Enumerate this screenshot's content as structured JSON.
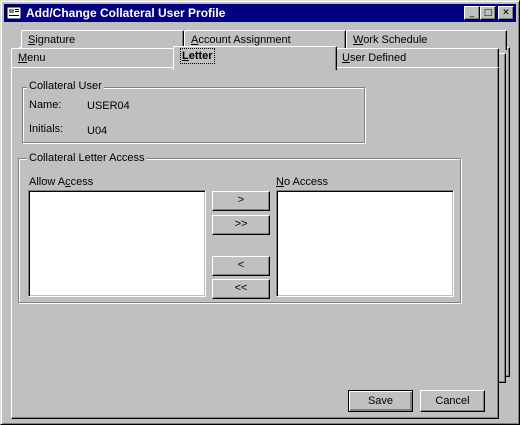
{
  "window": {
    "title": "Add/Change Collateral User Profile",
    "controls": {
      "minimize": "_",
      "maximize": "□",
      "close": "✕"
    }
  },
  "tabs": {
    "back_row": [
      {
        "label": "Signature",
        "mnemonic": "S",
        "rest": "ignature"
      },
      {
        "label": "Account Assignment",
        "mnemonic": "A",
        "rest": "ccount Assignment"
      },
      {
        "label": "Work Schedule",
        "mnemonic": "W",
        "rest": "ork Schedule"
      }
    ],
    "front_row": [
      {
        "label": "Menu",
        "mnemonic": "M",
        "rest": "enu"
      },
      {
        "label": "Letter",
        "mnemonic": "L",
        "rest": "etter",
        "selected": true
      },
      {
        "label": "User Defined",
        "mnemonic": "U",
        "rest": "ser Defined"
      }
    ]
  },
  "collateral_user": {
    "group_label": "Collateral User",
    "name_label": "Name:",
    "name_value": "USER04",
    "initials_label": "Initials:",
    "initials_value": "U04"
  },
  "letter_access": {
    "group_label": "Collateral Letter Access",
    "allow_label_pre": "Allow A",
    "allow_label_mn": "c",
    "allow_label_post": "cess",
    "allow_items": [],
    "no_access_label_mn": "N",
    "no_access_label_post": "o Access",
    "no_items": [],
    "move_one_right": ">",
    "move_all_right": ">>",
    "move_one_left": "<",
    "move_all_left": "<<"
  },
  "footer": {
    "save_label": "Save",
    "cancel_label": "Cancel"
  },
  "colors": {
    "titlebar": "#000080",
    "face": "#c0c0c0"
  }
}
